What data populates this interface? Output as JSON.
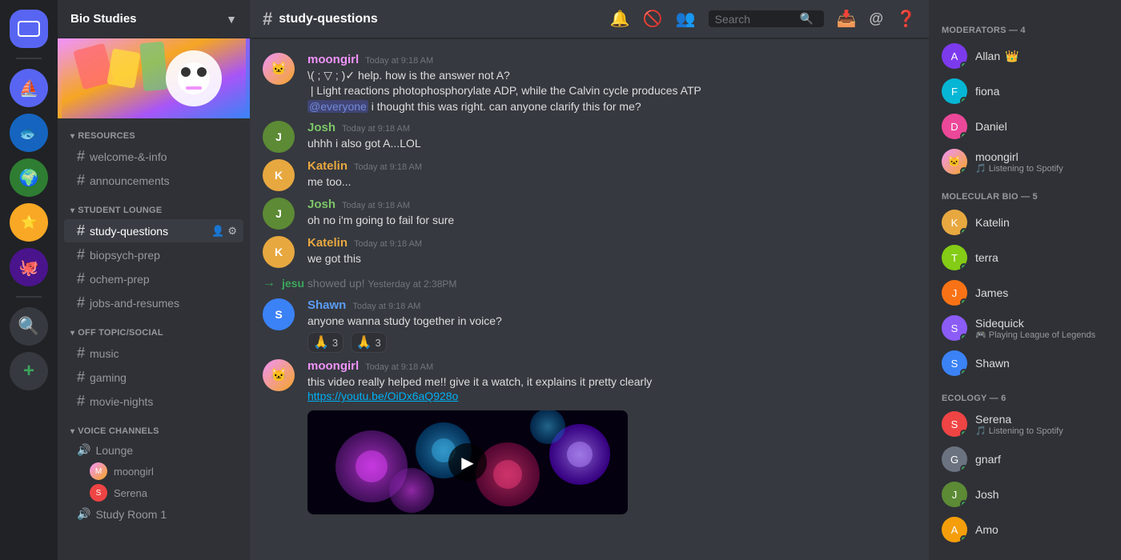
{
  "serverBar": {
    "servers": [
      {
        "id": "home",
        "label": "Home",
        "icon": "🏠",
        "type": "home"
      },
      {
        "id": "ship",
        "label": "Ship Server",
        "icon": "⛵",
        "color": "#5865f2"
      },
      {
        "id": "fish",
        "label": "Fish Server",
        "icon": "🐟",
        "color": "#1e88e5"
      },
      {
        "id": "planet",
        "label": "Planet Server",
        "icon": "🌍",
        "color": "#2e7d32"
      },
      {
        "id": "yellow",
        "label": "Yellow Server",
        "icon": "⭐",
        "color": "#f9a825"
      },
      {
        "id": "creature",
        "label": "Creature Server",
        "icon": "🐙",
        "color": "#6a1b9a"
      },
      {
        "id": "search",
        "label": "Search",
        "icon": "🔍",
        "color": "#36393f"
      },
      {
        "id": "add",
        "label": "Add Server",
        "icon": "+",
        "type": "add"
      }
    ]
  },
  "sidebar": {
    "serverName": "Bio Studies",
    "categories": [
      {
        "name": "RESOURCES",
        "channels": [
          {
            "name": "welcome-&-info",
            "type": "text"
          },
          {
            "name": "announcements",
            "type": "text"
          }
        ]
      },
      {
        "name": "STUDENT LOUNGE",
        "channels": [
          {
            "name": "study-questions",
            "type": "text",
            "active": true
          },
          {
            "name": "biopsych-prep",
            "type": "text"
          },
          {
            "name": "ochem-prep",
            "type": "text"
          },
          {
            "name": "jobs-and-resumes",
            "type": "text"
          }
        ]
      },
      {
        "name": "OFF TOPIC/SOCIAL",
        "channels": [
          {
            "name": "music",
            "type": "text"
          },
          {
            "name": "gaming",
            "type": "text"
          },
          {
            "name": "movie-nights",
            "type": "text"
          }
        ]
      },
      {
        "name": "VOICE CHANNELS",
        "channels": [
          {
            "name": "Lounge",
            "type": "voice"
          },
          {
            "name": "Study Room 1",
            "type": "voice"
          }
        ]
      }
    ],
    "voiceMembers": {
      "Lounge": [
        "moongirl",
        "Serena"
      ]
    }
  },
  "chat": {
    "channelName": "study-questions",
    "messages": [
      {
        "id": 1,
        "author": "moongirl",
        "authorClass": "author-moongirl",
        "avatarClass": "av-moongirl",
        "time": "Today at 9:18 AM",
        "lines": [
          "\\( ; ▽ ; )✓ help. how is the answer not A?",
          "| Light reactions photophosphorylate ADP, while the Calvin cycle produces ATP",
          "@everyone i thought this was right. can anyone clarify this for me?"
        ],
        "hasMention": true
      },
      {
        "id": 2,
        "author": "Josh",
        "authorClass": "author-josh",
        "avatarClass": "av-josh",
        "time": "Today at 9:18 AM",
        "lines": [
          "uhhh i also got A...LOL"
        ]
      },
      {
        "id": 3,
        "author": "Katelin",
        "authorClass": "author-katelin",
        "avatarClass": "av-katelin",
        "time": "Today at 9:18 AM",
        "lines": [
          "me too..."
        ]
      },
      {
        "id": 4,
        "author": "Josh",
        "authorClass": "author-josh",
        "avatarClass": "av-josh",
        "time": "Today at 9:18 AM",
        "lines": [
          "oh no i'm going to fail for sure"
        ]
      },
      {
        "id": 5,
        "author": "Katelin",
        "authorClass": "author-katelin",
        "avatarClass": "av-katelin",
        "time": "Today at 9:18 AM",
        "lines": [
          "we got this"
        ]
      },
      {
        "id": 6,
        "type": "system",
        "user": "jesu",
        "text": "showed up!",
        "time": "Yesterday at 2:38PM"
      },
      {
        "id": 7,
        "author": "Shawn",
        "authorClass": "author-shawn",
        "avatarClass": "av-shawn",
        "time": "Today at 9:18 AM",
        "lines": [
          "anyone wanna study together in voice?"
        ],
        "reactions": [
          {
            "emoji": "🙏",
            "count": 3
          },
          {
            "emoji": "🙏",
            "count": 3
          }
        ]
      },
      {
        "id": 8,
        "author": "moongirl",
        "authorClass": "author-moongirl",
        "avatarClass": "av-moongirl",
        "time": "Today at 9:18 AM",
        "lines": [
          "this video really helped me!! give it a watch, it explains it pretty clearly"
        ],
        "link": "https://youtu.be/OiDx6aQ928o",
        "hasVideo": true
      }
    ]
  },
  "members": {
    "categories": [
      {
        "name": "MODERATORS — 4",
        "members": [
          {
            "name": "Allan",
            "badge": "👑",
            "status": "online",
            "avatarClass": "av-allan"
          },
          {
            "name": "fiona",
            "badge": "",
            "status": "online",
            "avatarClass": "av-fiona"
          },
          {
            "name": "Daniel",
            "badge": "",
            "status": "online",
            "avatarClass": "av-daniel"
          },
          {
            "name": "moongirl",
            "badge": "",
            "status": "online",
            "avatarClass": "av-moongirl",
            "statusText": "Listening to Spotify",
            "statusIcon": "🎵"
          }
        ]
      },
      {
        "name": "MOLECULAR BIO — 5",
        "members": [
          {
            "name": "Katelin",
            "badge": "",
            "status": "online",
            "avatarClass": "av-katelin"
          },
          {
            "name": "terra",
            "badge": "",
            "status": "online",
            "avatarClass": "av-terra"
          },
          {
            "name": "James",
            "badge": "",
            "status": "online",
            "avatarClass": "av-james"
          },
          {
            "name": "Sidequick",
            "badge": "",
            "status": "online",
            "avatarClass": "av-sidequick",
            "statusText": "Playing League of Legends",
            "statusIcon": "🎮"
          },
          {
            "name": "Shawn",
            "badge": "",
            "status": "online",
            "avatarClass": "av-shawn"
          }
        ]
      },
      {
        "name": "ECOLOGY — 6",
        "members": [
          {
            "name": "Serena",
            "badge": "",
            "status": "online",
            "avatarClass": "av-serena",
            "statusText": "Listening to Spotify",
            "statusIcon": "🎵"
          },
          {
            "name": "gnarf",
            "badge": "",
            "status": "online",
            "avatarClass": "av-gnarf"
          },
          {
            "name": "Josh",
            "badge": "",
            "status": "online",
            "avatarClass": "av-josh"
          },
          {
            "name": "Amo",
            "badge": "",
            "status": "online",
            "avatarClass": "av-amo"
          }
        ]
      }
    ]
  },
  "header": {
    "channelName": "study-questions",
    "searchPlaceholder": "Search"
  },
  "icons": {
    "bell": "🔔",
    "pin": "📌",
    "people": "👥",
    "search": "🔍",
    "inbox": "📥",
    "help": "❓",
    "at": "@"
  }
}
